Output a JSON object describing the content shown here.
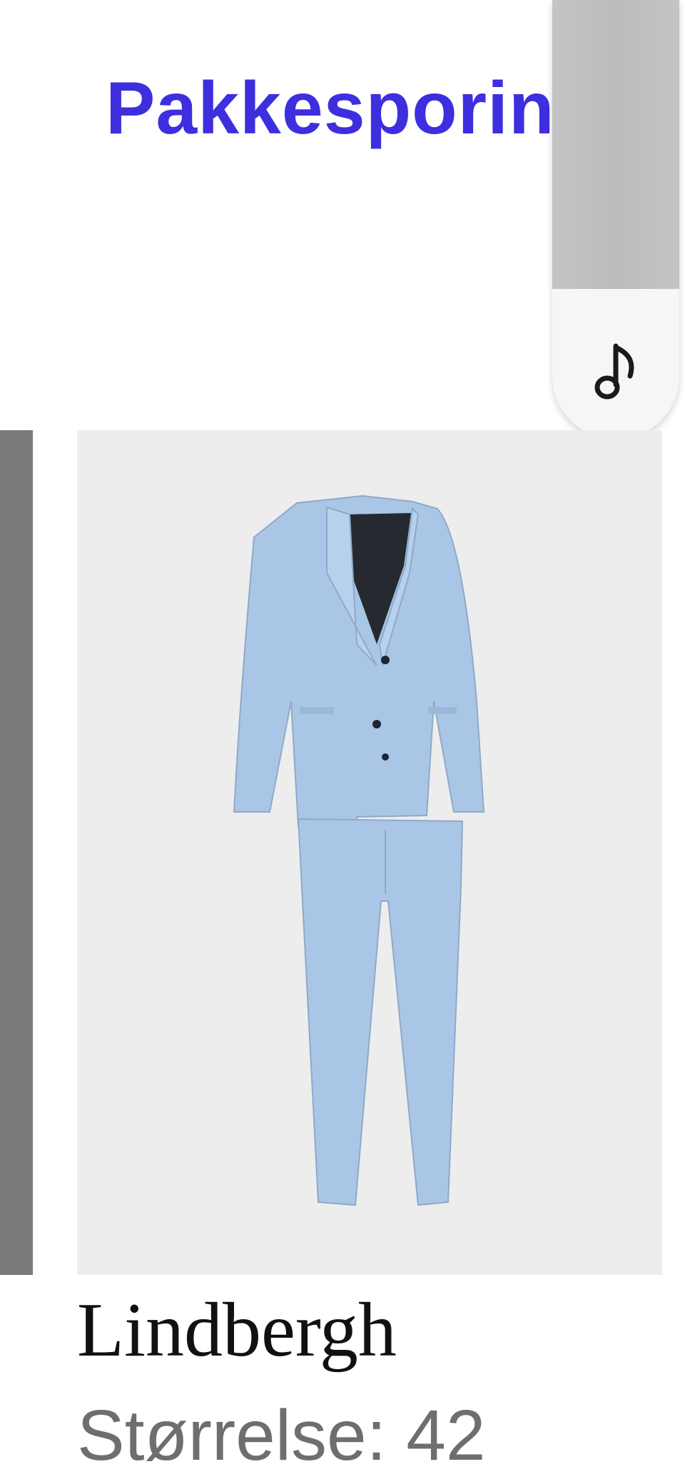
{
  "header": {
    "title": "Pakkesporing"
  },
  "overlay": {
    "button_icon": "music-note-icon"
  },
  "product": {
    "name": "Lindbergh",
    "size_label": "Størrelse:",
    "size_value": "42",
    "image_icon": "suit-image",
    "image_colors": {
      "suit": "#a9c6e6",
      "background": "#ededed"
    }
  }
}
